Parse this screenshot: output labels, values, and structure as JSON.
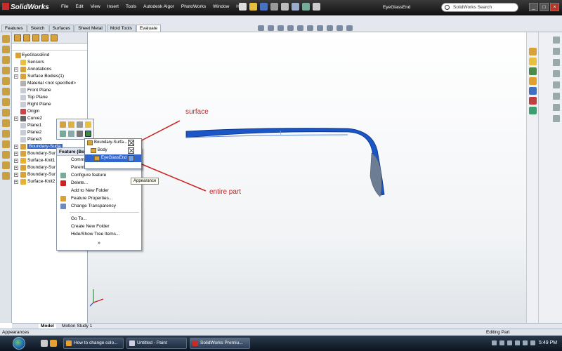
{
  "app": {
    "logo_text": "SolidWorks",
    "menu": [
      "File",
      "Edit",
      "View",
      "Insert",
      "Tools",
      "Autodesk Algor",
      "PhotoWorks",
      "Window",
      "Help"
    ],
    "document_title": "EyeGlassEnd",
    "search_placeholder": "SolidWorks Search"
  },
  "command_tabs": [
    "Features",
    "Sketch",
    "Surfaces",
    "Sheet Metal",
    "Mold Tools",
    "Evaluate"
  ],
  "feature_tree": {
    "root": "EyeGlassEnd",
    "items": [
      {
        "label": "Sensors",
        "level": 1,
        "icon": "sensor-icon",
        "expandable": false
      },
      {
        "label": "Annotations",
        "level": 1,
        "icon": "annotation-icon",
        "expandable": true
      },
      {
        "label": "Surface Bodies(1)",
        "level": 1,
        "icon": "surface-body-icon",
        "expandable": true
      },
      {
        "label": "Material <not specified>",
        "level": 1,
        "icon": "material-icon",
        "expandable": false
      },
      {
        "label": "Front Plane",
        "level": 1,
        "icon": "plane-icon",
        "expandable": false
      },
      {
        "label": "Top Plane",
        "level": 1,
        "icon": "plane-icon",
        "expandable": false
      },
      {
        "label": "Right Plane",
        "level": 1,
        "icon": "plane-icon",
        "expandable": false
      },
      {
        "label": "Origin",
        "level": 1,
        "icon": "origin-icon",
        "expandable": false
      },
      {
        "label": "Curve2",
        "level": 1,
        "icon": "curve-icon",
        "expandable": true
      },
      {
        "label": "Plane1",
        "level": 1,
        "icon": "plane-icon",
        "expandable": false
      },
      {
        "label": "Plane2",
        "level": 1,
        "icon": "plane-icon",
        "expandable": false
      },
      {
        "label": "Plane3",
        "level": 1,
        "icon": "plane-icon",
        "expandable": false
      },
      {
        "label": "Boundary-Surfa",
        "level": 1,
        "icon": "boundary-surface-icon",
        "expandable": true,
        "selected": true
      },
      {
        "label": "Boundary-Sur",
        "level": 1,
        "icon": "boundary-surface-icon",
        "expandable": true
      },
      {
        "label": "Surface-Knit1",
        "level": 1,
        "icon": "knit-icon",
        "expandable": true
      },
      {
        "label": "Boundary-Sur",
        "level": 1,
        "icon": "boundary-surface-icon",
        "expandable": true
      },
      {
        "label": "Boundary-Sur",
        "level": 1,
        "icon": "boundary-surface-icon",
        "expandable": true
      },
      {
        "label": "Surface-Knit2",
        "level": 1,
        "icon": "knit-icon",
        "expandable": true
      }
    ]
  },
  "context_menu": {
    "header": "Feature (Bou",
    "items": [
      {
        "label": "Comm",
        "icon": ""
      },
      {
        "label": "Parent",
        "icon": ""
      },
      {
        "label": "Configure feature",
        "icon": "configure-icon"
      },
      {
        "label": "Delete...",
        "icon": "delete-icon"
      },
      {
        "label": "Add to New Folder",
        "icon": ""
      },
      {
        "label": "Feature Properties...",
        "icon": "properties-icon"
      },
      {
        "label": "Change Transparency",
        "icon": "transparency-icon"
      }
    ],
    "items2": [
      {
        "label": "Go To..."
      },
      {
        "label": "Create New Folder"
      },
      {
        "label": "Hide/Show Tree Items..."
      }
    ],
    "more": "»"
  },
  "appearance_popup": {
    "rows": [
      "Boundary-Surfa...",
      "Body",
      "EyeGlassEnd"
    ],
    "tooltip": "Appearance"
  },
  "annotations": {
    "surface": "surface",
    "entire_part": "entire part"
  },
  "bottom_tabs": [
    "Model",
    "Motion Study 1"
  ],
  "status": {
    "left": "Appearances",
    "right": "Editing Part"
  },
  "taskbar": {
    "tasks": [
      "How to change colo...",
      "Untitled - Paint",
      "SolidWorks Premiu..."
    ],
    "clock": "5:49 PM"
  },
  "colors": {
    "accent": "#3366cc",
    "part_blue": "#1a56c8",
    "annotation_red": "#cc2222"
  }
}
